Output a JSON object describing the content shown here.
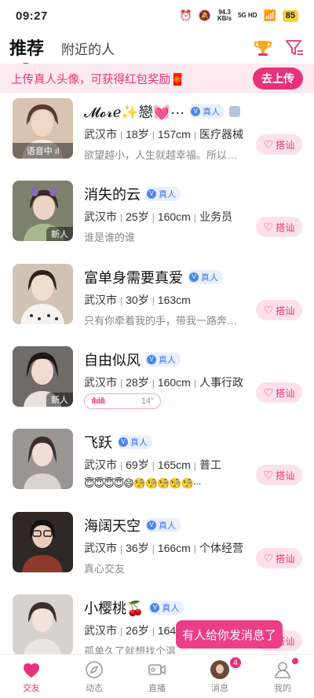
{
  "status_bar": {
    "time": "09:27",
    "net_speed": "94.3",
    "net_unit": "KB/s",
    "net_type": "5G HD",
    "battery": "85"
  },
  "top_nav": {
    "tab_recommend": "推荐",
    "tab_nearby": "附近的人"
  },
  "banner": {
    "text": "上传真人头像，可获得红包奖励🧧",
    "button": "去上传"
  },
  "verified_label": "真人",
  "greet_label": "搭讪",
  "users": [
    {
      "name": "𝓜𝓸𝓻ℯ✨戀💓···",
      "info": [
        "武汉市",
        "18岁",
        "157cm",
        "医疗器械"
      ],
      "sub": "欲望越小，人生就越幸福。所以…",
      "avatar_badge": "语音中 ıl",
      "avatar_color": "#c9a995"
    },
    {
      "name": "消失的云",
      "info": [
        "武汉市",
        "25岁",
        "160cm",
        "业务员"
      ],
      "sub": "谁是谁的谁",
      "avatar_badge": "新人",
      "avatar_color": "#8a8d7a"
    },
    {
      "name": "富单身需要真爱",
      "info": [
        "武汉市",
        "30岁",
        "163cm"
      ],
      "sub": "只有你牵着我的手，带我一路奔…",
      "avatar_badge": "",
      "avatar_color": "#b8a89a"
    },
    {
      "name": "自由似风",
      "info": [
        "武汉市",
        "28岁",
        "160cm",
        "人事行政"
      ],
      "voice_duration": "14\"",
      "avatar_badge": "新人",
      "avatar_color": "#7c7a78"
    },
    {
      "name": "飞跃",
      "info": [
        "武汉市",
        "69岁",
        "165cm",
        "普工"
      ],
      "sub": "😇😇😇😇😄🧐🧐🧐🧐🧐···",
      "avatar_badge": "",
      "avatar_color": "#8a8686"
    },
    {
      "name": "海阔天空",
      "info": [
        "武汉市",
        "36岁",
        "166cm",
        "个体经营"
      ],
      "sub": "真心交友",
      "avatar_badge": "",
      "avatar_color": "#4a4440"
    },
    {
      "name": "小樱桃🍒",
      "info": [
        "武汉市",
        "26岁",
        "164c"
      ],
      "sub": "孤单久了就想找个温",
      "avatar_badge": "",
      "avatar_color": "#c7c2bf"
    }
  ],
  "toast": "有人给你发消息了",
  "bottom_nav": {
    "friends": "交友",
    "moments": "动态",
    "live": "直播",
    "messages": "消息",
    "messages_badge": "4",
    "me": "我的"
  },
  "colors": {
    "accent": "#e8317a",
    "banner_bg": "#fde9f0",
    "verified": "#3a74e8"
  }
}
